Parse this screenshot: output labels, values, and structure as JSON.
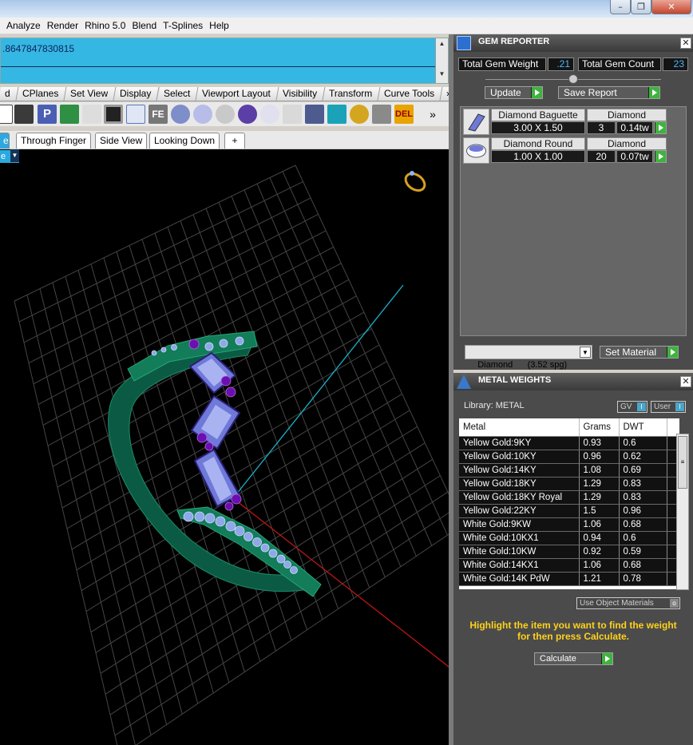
{
  "menu": [
    "Analyze",
    "Render",
    "Rhino 5.0",
    "Blend",
    "T-Splines",
    "Help"
  ],
  "command_output": ".8647847830815",
  "toolbar_tabs": [
    "d",
    "CPlanes",
    "Set View",
    "Display",
    "Select",
    "Viewport Layout",
    "Visibility",
    "Transform",
    "Curve Tools",
    "»"
  ],
  "viewport_tabs": [
    "e",
    "Through Finger",
    "Side View",
    "Looking Down",
    "+"
  ],
  "viewport_label": "e",
  "gem_reporter": {
    "title": "GEM REPORTER",
    "total_weight_label": "Total Gem Weight",
    "total_weight_value": ".21",
    "total_count_label": "Total Gem Count",
    "total_count_value": "23",
    "update_label": "Update",
    "save_report_label": "Save Report",
    "gems": [
      {
        "name": "Diamond Baguette",
        "material": "Diamond",
        "size": "3.00 X 1.50",
        "count": "3",
        "weight": "0.14tw"
      },
      {
        "name": "Diamond Round",
        "material": "Diamond",
        "size": "1.00 X 1.00",
        "count": "20",
        "weight": "0.07tw"
      }
    ],
    "material_select": "Diamond      (3.52 spg)",
    "set_material_label": "Set Material"
  },
  "metal_weights": {
    "title": "METAL WEIGHTS",
    "library_label": "Library: METAL",
    "gv_label": "GV",
    "user_label": "User",
    "headers": [
      "Metal",
      "Grams",
      "DWT"
    ],
    "rows": [
      [
        "Yellow Gold:9KY",
        "0.93",
        "0.6"
      ],
      [
        "Yellow Gold:10KY",
        "0.96",
        "0.62"
      ],
      [
        "Yellow Gold:14KY",
        "1.08",
        "0.69"
      ],
      [
        "Yellow Gold:18KY",
        "1.29",
        "0.83"
      ],
      [
        "Yellow Gold:18KY Royal",
        "1.29",
        "0.83"
      ],
      [
        "Yellow Gold:22KY",
        "1.5",
        "0.96"
      ],
      [
        "White Gold:9KW",
        "1.06",
        "0.68"
      ],
      [
        "White Gold:10KX1",
        "0.94",
        "0.6"
      ],
      [
        "White Gold:10KW",
        "0.92",
        "0.59"
      ],
      [
        "White Gold:14KX1",
        "1.06",
        "0.68"
      ],
      [
        "White Gold:14K PdW",
        "1.21",
        "0.78"
      ]
    ],
    "use_object_materials_label": "Use Object Materials",
    "instruction": "Highlight the item you want to find the weight for then press Calculate.",
    "calculate_label": "Calculate"
  }
}
